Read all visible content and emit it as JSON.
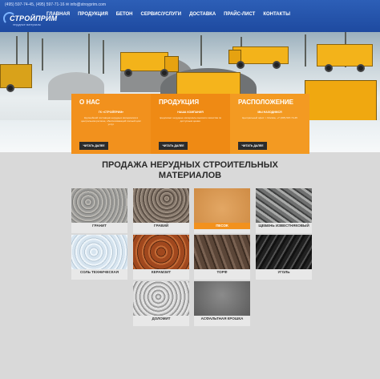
{
  "header": {
    "contacts": "(495) 597-74-45, (495) 597-71-16  ✉ info@stroyprim.com",
    "logo_text": "СТРОЙПРИМ",
    "logo_sub": "нерудные материалы",
    "nav": [
      "ГЛАВНАЯ",
      "ПРОДУКЦИЯ",
      "БЕТОН",
      "СЕРВИС/УСЛУГИ",
      "ДОСТАВКА",
      "ПРАЙС-ЛИСТ",
      "КОНТАКТЫ"
    ]
  },
  "cards": [
    {
      "title": "О НАС",
      "sub": "ГК «СТРОЙПРИМ»",
      "text": "Крупнейший поставщик нерудных материалов в центральном регионе, обеспечивающий полный цикл услуг.",
      "button": "ЧИТАТЬ ДАЛЕЕ"
    },
    {
      "title": "ПРОДУКЦИЯ",
      "sub": "НАША КОМПАНИЯ",
      "text": "предлагает нерудные материалы высокого качества по доступным ценам.",
      "button": "ЧИТАТЬ ДАЛЕЕ"
    },
    {
      "title": "РАСПОЛОЖЕНИЕ",
      "sub": "МЫ НАХОДИМСЯ",
      "text": "Центральный офис: г. Москва, +7 (495) 597-74-45",
      "button": "ЧИТАТЬ ДАЛЕЕ"
    }
  ],
  "section": {
    "title": "ПРОДАЖА НЕРУДНЫХ СТРОИТЕЛЬНЫХ МАТЕРИАЛОВ"
  },
  "materials": [
    "ГРАНИТ",
    "ГРАВИЙ",
    "ПЕСОК",
    "ЩЕБЕНЬ ИЗВЕСТНЯКОВЫЙ",
    "СОЛЬ ТЕХНИЧЕСКАЯ",
    "КЕРАМЗИТ",
    "ТОРФ",
    "УГОЛЬ",
    "ДОЛОМИТ",
    "АСФАЛЬТНАЯ КРОШКА"
  ],
  "colors": {
    "header_blue": "#2d5fb7",
    "accent_orange": "#f2911d",
    "button_dark": "#2b2b2b"
  }
}
